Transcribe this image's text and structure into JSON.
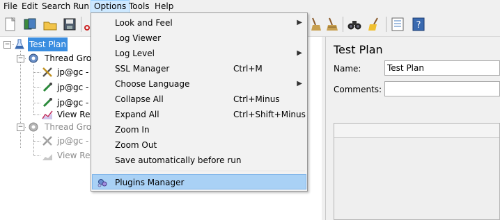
{
  "menubar": {
    "items": [
      "File",
      "Edit",
      "Search",
      "Run",
      "Options",
      "Tools",
      "Help"
    ]
  },
  "toolbar": {
    "icons": [
      "new-plan-icon",
      "templates-icon",
      "open-icon",
      "save-icon",
      "cut-icon",
      "broom-clear-icon",
      "broom-clear-all-icon",
      "binoculars-search-icon",
      "clear-search-icon",
      "function-helper-icon",
      "help-icon"
    ]
  },
  "tree": {
    "nodes": [
      {
        "label": "Test Plan"
      },
      {
        "label": "Thread Grou"
      },
      {
        "label": "jp@gc -"
      },
      {
        "label": "jp@gc -"
      },
      {
        "label": "jp@gc -"
      },
      {
        "label": "View Re"
      },
      {
        "label": "Thread Grou"
      },
      {
        "label": "jp@gc -"
      },
      {
        "label": "View Re"
      }
    ]
  },
  "options_menu": {
    "items": [
      {
        "label": "Look and Feel",
        "accel": "",
        "submenu": true
      },
      {
        "label": "Log Viewer",
        "accel": "",
        "submenu": false
      },
      {
        "label": "Log Level",
        "accel": "",
        "submenu": true
      },
      {
        "label": "SSL Manager",
        "accel": "Ctrl+M",
        "submenu": false
      },
      {
        "label": "Choose Language",
        "accel": "",
        "submenu": true
      },
      {
        "label": "Collapse All",
        "accel": "Ctrl+Minus",
        "submenu": false
      },
      {
        "label": "Expand All",
        "accel": "Ctrl+Shift+Minus",
        "submenu": false
      },
      {
        "label": "Zoom In",
        "accel": "",
        "submenu": false
      },
      {
        "label": "Zoom Out",
        "accel": "",
        "submenu": false
      },
      {
        "label": "Save automatically before run",
        "accel": "",
        "submenu": false
      },
      {
        "label": "Plugins Manager",
        "accel": "",
        "submenu": false
      }
    ]
  },
  "right_panel": {
    "title": "Test Plan",
    "name_label": "Name:",
    "name_value": "Test Plan",
    "comments_label": "Comments:",
    "comments_value": ""
  },
  "colors": {
    "selection": "#3a8de0",
    "menu_highlight": "#a9d1f5",
    "active_menu": "#cde8ff"
  }
}
